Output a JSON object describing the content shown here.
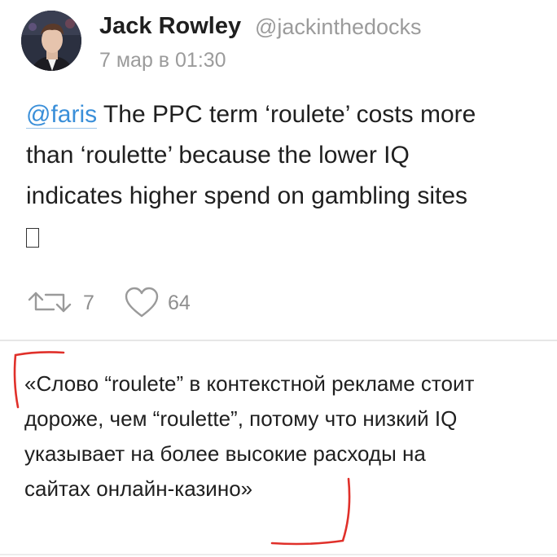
{
  "author": {
    "name": "Jack Rowley",
    "handle": "@jackinthedocks",
    "date": "7 мар в 01:30"
  },
  "tweet": {
    "mention": "@faris",
    "line1_rest": " The PPC term ‘roulete’ costs more",
    "line2": "than ‘roulette’ because the lower IQ",
    "line3": "indicates higher spend on gambling sites"
  },
  "actions": {
    "retweet_count": "7",
    "like_count": "64"
  },
  "translation": {
    "line1": "«Слово “roulete” в контекстной рекламе стоит",
    "line2": "дороже, чем “roulette”, потому что низкий IQ",
    "line3": "указывает на более высокие расходы на",
    "line4": "сайтах онлайн-казино»"
  },
  "colors": {
    "mention": "#3a8fd9",
    "meta_gray": "#9b9b9b",
    "bracket_red": "#e0302a"
  }
}
